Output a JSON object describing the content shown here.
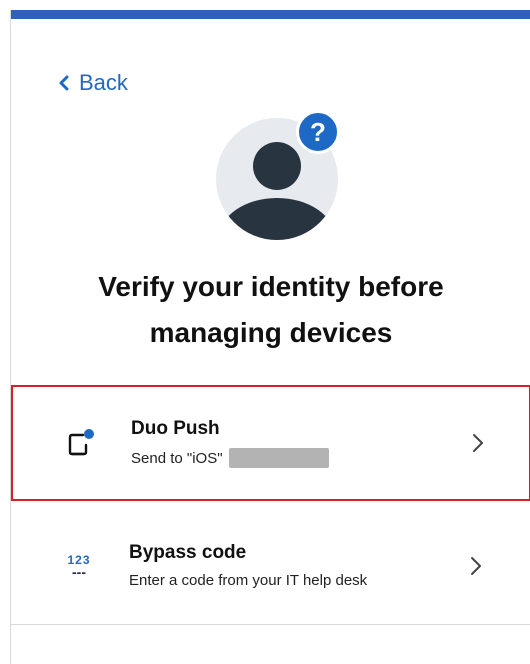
{
  "back": {
    "label": "Back"
  },
  "avatar": {
    "badge": "?"
  },
  "title": {
    "line1": "Verify your identity before",
    "line2": "managing devices"
  },
  "options": [
    {
      "label": "Duo Push",
      "subtitle": "Send to \"iOS\"",
      "icon": "phone-push-icon",
      "selected": true
    },
    {
      "label": "Bypass code",
      "subtitle": "Enter a code from your IT help desk",
      "icon": "bypass-code-icon",
      "icon_text": "123"
    }
  ],
  "colors": {
    "accent": "#1f69c6",
    "topbar": "#2e62b8",
    "highlight": "#d6202a",
    "avatar_dark": "#283440"
  }
}
